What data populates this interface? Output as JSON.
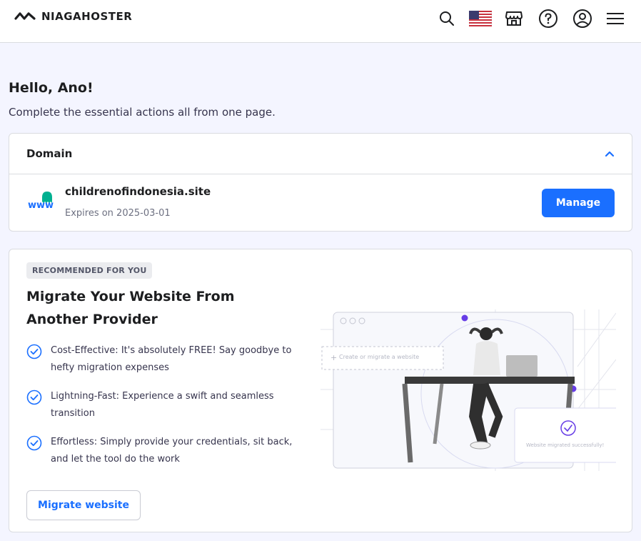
{
  "header": {
    "brand": "NIAGAHOSTER"
  },
  "greeting": {
    "title": "Hello, Ano!",
    "subtitle": "Complete the essential actions all from one page."
  },
  "domain": {
    "section_title": "Domain",
    "name": "childrenofindonesia.site",
    "expires": "Expires on 2025-03-01",
    "manage_label": "Manage",
    "www_label": "www"
  },
  "promo": {
    "badge": "RECOMMENDED FOR YOU",
    "title": "Migrate Your Website From Another Provider",
    "features": [
      "Cost-Effective: It's absolutely FREE! Say goodbye to hefty migration expenses",
      "Lightning-Fast: Experience a swift and seamless transition",
      "Effortless: Simply provide your credentials, sit back, and let the tool do the work"
    ],
    "button_label": "Migrate website",
    "illustration": {
      "create_label": "Create or migrate a website",
      "success_label": "Website migrated successfully!"
    }
  },
  "colors": {
    "accent": "#1a6fff",
    "purple": "#673de6",
    "teal": "#00b090"
  }
}
